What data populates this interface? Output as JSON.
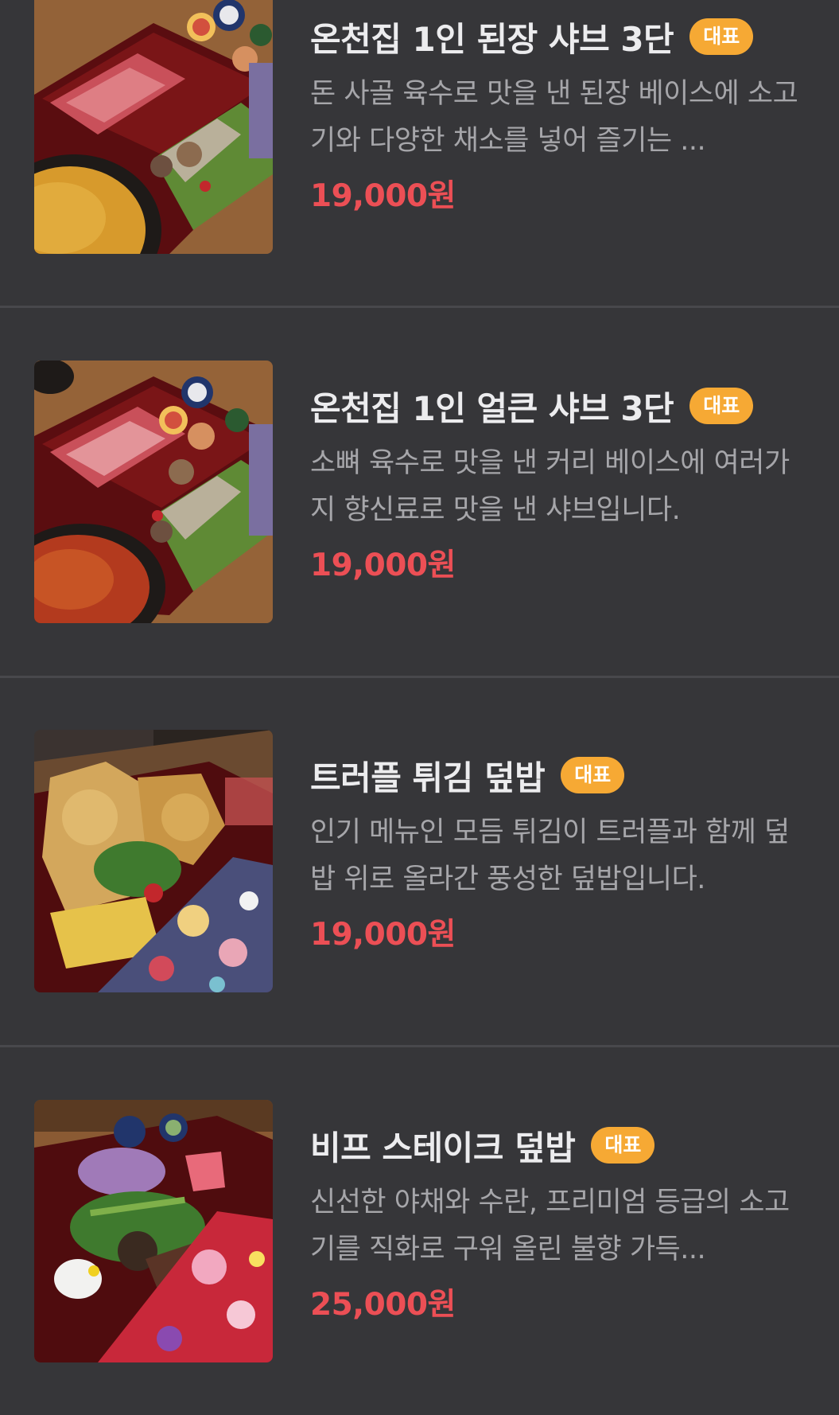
{
  "menu": {
    "badge_label": "대표",
    "items": [
      {
        "name": "온천집 1인 된장 샤브 3단",
        "description": "돈 사골 육수로 맛을 낸 된장 베이스에 소고기와 다양한 채소를 넣어 즐기는 ...",
        "price": "19,000원",
        "image": "shabu-tray-photo"
      },
      {
        "name": "온천집 1인 얼큰 샤브 3단",
        "description": "소뼈 육수로 맛을 낸 커리 베이스에 여러가지 향신료로 맛을 낸 샤브입니다.",
        "price": "19,000원",
        "image": "shabu-tray-photo"
      },
      {
        "name": "트러플 튀김 덮밥",
        "description": "인기 메뉴인 모듬 튀김이 트러플과 함께 덮밥 위로 올라간 풍성한 덮밥입니다.",
        "price": "19,000원",
        "image": "tempura-bowl-photo"
      },
      {
        "name": "비프 스테이크 덮밥",
        "description": "신선한 야채와 수란, 프리미엄 등급의 소고기를 직화로 구워 올린 불향 가득...",
        "price": "25,000원",
        "image": "steak-bowl-photo"
      }
    ]
  },
  "colors": {
    "background": "#363639",
    "divider": "#48484c",
    "title": "#ececee",
    "description": "#a6a6aa",
    "price": "#ec4f55",
    "badge": "#f6a934"
  }
}
